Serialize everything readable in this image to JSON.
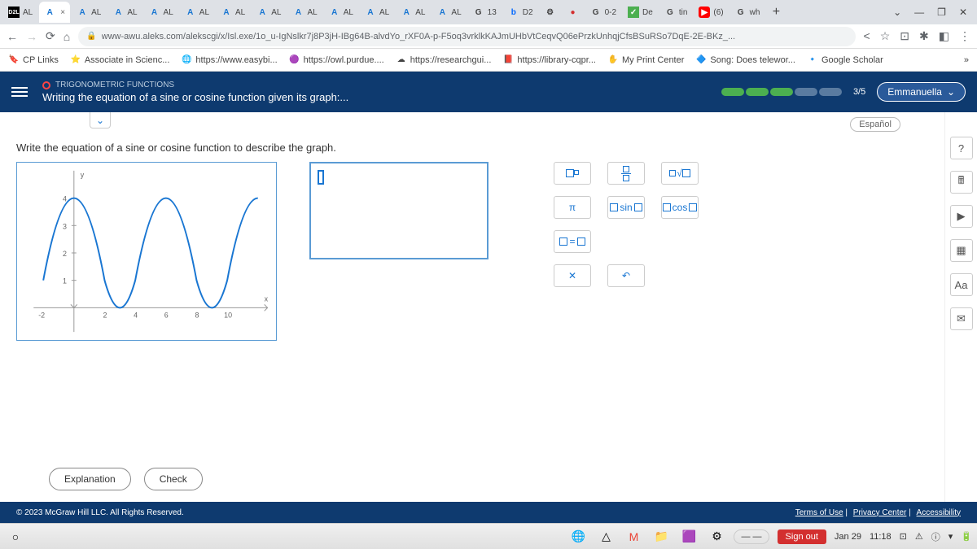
{
  "tabs": {
    "labels": [
      "AL",
      "A",
      "AL",
      "AL",
      "AL",
      "AL",
      "AL",
      "AL",
      "AL",
      "AL",
      "AL",
      "AL",
      "AL",
      "13",
      "D2",
      "",
      "",
      "0-2",
      "De",
      "tin",
      "(6)",
      "wh"
    ],
    "icons": [
      "D2L",
      "A",
      "A",
      "A",
      "A",
      "A",
      "A",
      "A",
      "A",
      "A",
      "A",
      "A",
      "A",
      "G",
      "b",
      "⚙",
      "●",
      "G",
      "✓",
      "G",
      "▶",
      "G"
    ]
  },
  "url": "www-awu.aleks.com/alekscgi/x/Isl.exe/1o_u-IgNslkr7j8P3jH-IBg64B-alvdYo_rXF0A-p-F5oq3vrklkKAJmUHbVtCeqvQ06ePrzkUnhqjCfsBSuRSo7DqE-2E-BKz_...",
  "bookmarks": [
    {
      "icon": "🔖",
      "label": "CP Links"
    },
    {
      "icon": "⭐",
      "label": "Associate in Scienc..."
    },
    {
      "icon": "🌐",
      "label": "https://www.easybi..."
    },
    {
      "icon": "🟣",
      "label": "https://owl.purdue...."
    },
    {
      "icon": "☁",
      "label": "https://researchgui..."
    },
    {
      "icon": "📕",
      "label": "https://library-cqpr..."
    },
    {
      "icon": "✋",
      "label": "My Print Center"
    },
    {
      "icon": "🔷",
      "label": "Song: Does telewor..."
    },
    {
      "icon": "🔹",
      "label": "Google Scholar"
    }
  ],
  "header": {
    "category": "TRIGONOMETRIC FUNCTIONS",
    "title": "Writing the equation of a sine or cosine function given its graph:...",
    "progress": "3/5",
    "user": "Emmanuella"
  },
  "body": {
    "lang": "Español",
    "prompt": "Write the equation of a sine or cosine function to describe the graph."
  },
  "keypad": {
    "pi": "π",
    "sin": "sin",
    "cos": "cos",
    "eq": "="
  },
  "buttons": {
    "explain": "Explanation",
    "check": "Check"
  },
  "footer": {
    "copyright": "© 2023 McGraw Hill LLC. All Rights Reserved.",
    "terms": "Terms of Use",
    "privacy": "Privacy Center",
    "access": "Accessibility"
  },
  "taskbar": {
    "signout": "Sign out",
    "date": "Jan 29",
    "time": "11:18"
  },
  "chart_data": {
    "type": "line",
    "title": "",
    "xlabel": "x",
    "ylabel": "y",
    "xlim": [
      -2,
      11
    ],
    "ylim": [
      -1,
      5
    ],
    "xticks": [
      -2,
      2,
      4,
      6,
      8,
      10
    ],
    "yticks": [
      1,
      2,
      3,
      4
    ],
    "curve_desc": "y = 2*cos((pi/3)*x) + 2",
    "x": [
      -2,
      -1,
      0,
      1,
      2,
      3,
      4,
      5,
      6,
      7,
      8,
      9,
      10,
      11
    ],
    "y": [
      1.0,
      3.0,
      4.0,
      3.0,
      1.0,
      0.0,
      1.0,
      3.0,
      4.0,
      3.0,
      1.0,
      0.0,
      1.0,
      3.0
    ]
  }
}
